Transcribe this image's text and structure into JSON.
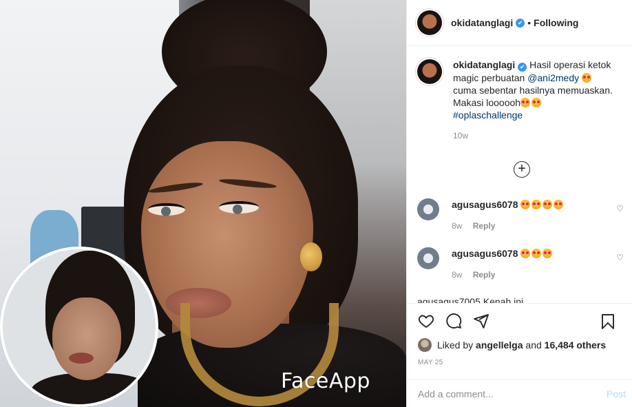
{
  "photo": {
    "watermark": "FaceApp"
  },
  "header": {
    "username": "okidatanglagi",
    "verified_glyph": "✔",
    "separator": "•",
    "follow_status": "Following"
  },
  "caption": {
    "username": "okidatanglagi",
    "text_part1": "Hasil operasi ketok magic perbuatan",
    "mention": "@ani2medy",
    "text_part2": "cuma sebentar hasilnya memuaskan. Makasi loooooh",
    "hashtag": "#oplaschallenge",
    "age": "10w"
  },
  "load_more_label": "+",
  "comments": [
    {
      "username": "agusagus6078",
      "emoji_count": 4,
      "age": "8w",
      "reply_label": "Reply"
    },
    {
      "username": "agusagus6078",
      "emoji_count": 3,
      "age": "8w",
      "reply_label": "Reply"
    }
  ],
  "partial_comment": "agusagus7005 Kenah ini",
  "likes": {
    "prefix": "Liked by",
    "user": "angellelga",
    "middle": "and",
    "others": "16,484 others"
  },
  "date": "MAY 25",
  "add_comment": {
    "placeholder": "Add a comment...",
    "post_label": "Post"
  },
  "icons": {
    "like": "heart-icon",
    "comment": "comment-icon",
    "share": "share-icon",
    "save": "bookmark-icon"
  },
  "colors": {
    "link": "#00376b",
    "verified": "#3897f0",
    "muted": "#8e8e8e",
    "post_disabled": "#b3dbff"
  }
}
